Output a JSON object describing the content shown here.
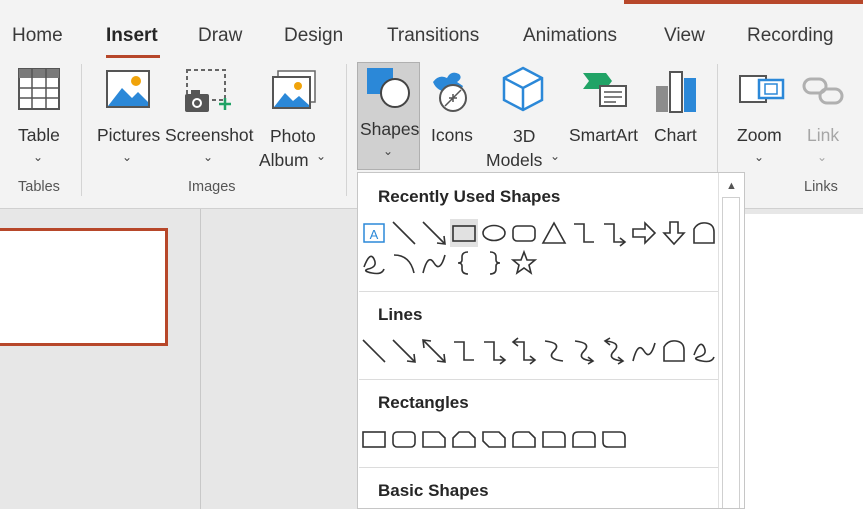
{
  "tabs": [
    "Home",
    "Insert",
    "Draw",
    "Design",
    "Transitions",
    "Animations",
    "View",
    "Recording"
  ],
  "active_tab": "Insert",
  "ribbon": {
    "table": {
      "label": "Table"
    },
    "pictures": {
      "label": "Pictures"
    },
    "screenshot": {
      "label": "Screenshot"
    },
    "photo_album": {
      "line1": "Photo",
      "line2": "Album"
    },
    "shapes": {
      "label": "Shapes"
    },
    "icons": {
      "label": "Icons"
    },
    "models3d": {
      "line1": "3D",
      "line2": "Models"
    },
    "smartart": {
      "label": "SmartArt"
    },
    "chart": {
      "label": "Chart"
    },
    "zoom": {
      "label": "Zoom"
    },
    "link": {
      "label": "Link"
    },
    "groups": {
      "tables": "Tables",
      "images": "Images",
      "links": "Links"
    }
  },
  "shapes_menu": {
    "sections": {
      "recent": "Recently Used Shapes",
      "lines": "Lines",
      "rectangles": "Rectangles",
      "basic": "Basic Shapes"
    },
    "recent_row1": [
      "text-box-shape",
      "line-shape",
      "arrow-line-shape",
      "rectangle-shape",
      "oval-shape",
      "rounded-rectangle-shape",
      "triangle-shape",
      "elbow-connector-shape",
      "elbow-arrow-connector-shape",
      "right-arrow-shape",
      "down-arrow-shape",
      "freeform-shape"
    ],
    "recent_row2": [
      "scribble-shape",
      "arc-shape",
      "curve-shape",
      "left-brace-shape",
      "right-brace-shape",
      "star-shape"
    ],
    "lines": [
      "line-shape",
      "arrow-line-shape",
      "double-arrow-line-shape",
      "elbow-connector-shape",
      "elbow-arrow-connector-shape",
      "elbow-double-arrow-connector-shape",
      "curved-connector-shape",
      "curved-arrow-connector-shape",
      "curved-double-arrow-connector-shape",
      "curve-shape",
      "freeform-shape",
      "scribble-shape"
    ],
    "rectangles": [
      "rectangle-shape",
      "rounded-rectangle-shape",
      "snip-single-corner-rectangle-shape",
      "snip-same-side-corner-rectangle-shape",
      "snip-diagonal-corner-rectangle-shape",
      "snip-round-rectangle-shape",
      "round-single-corner-rectangle-shape",
      "round-same-side-corner-rectangle-shape",
      "round-diagonal-corner-rectangle-shape"
    ],
    "selected": "rectangle-shape"
  },
  "colors": {
    "accent": "#b7472a",
    "icon_blue": "#2b88d8",
    "icon_green": "#21a366"
  }
}
